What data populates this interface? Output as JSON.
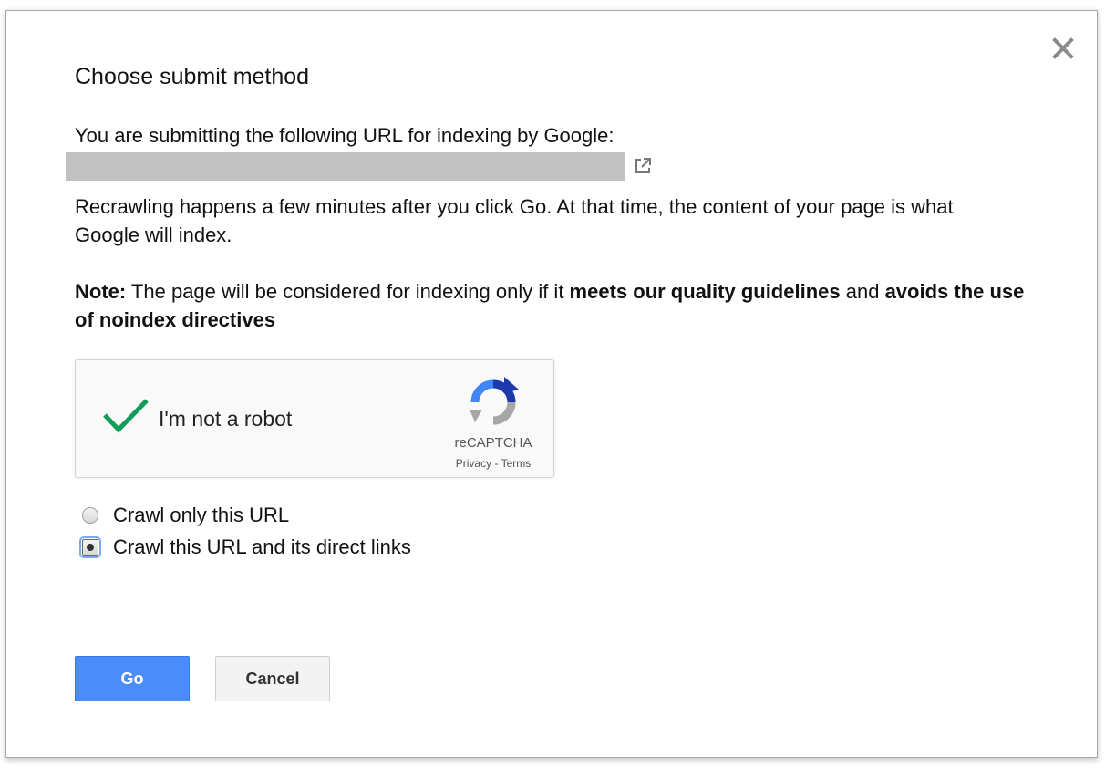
{
  "dialog": {
    "title": "Choose submit method",
    "intro": "You are submitting the following URL for indexing by Google:",
    "url_redacted": true,
    "recrawl_text": "Recrawling happens a few minutes after you click Go. At that time, the content of your page is what Google will index.",
    "note": {
      "label": "Note:",
      "text_1": " The page will be considered for indexing only if it ",
      "bold_1": "meets our quality guidelines",
      "text_2": " and ",
      "bold_2": "avoids the use of noindex directives"
    },
    "close_icon": "close-icon",
    "external_link_icon": "external-link-icon"
  },
  "captcha": {
    "label": "I'm not a robot",
    "checked": true,
    "brand": "reCAPTCHA",
    "privacy": "Privacy",
    "separator": " - ",
    "terms": "Terms",
    "check_color": "#0f9d58"
  },
  "crawl_options": [
    {
      "label": "Crawl only this URL",
      "selected": false
    },
    {
      "label": "Crawl this URL and its direct links",
      "selected": true
    }
  ],
  "buttons": {
    "go": "Go",
    "cancel": "Cancel"
  },
  "colors": {
    "primary_button": "#4b8df8",
    "redaction": "#c2c2c2"
  }
}
